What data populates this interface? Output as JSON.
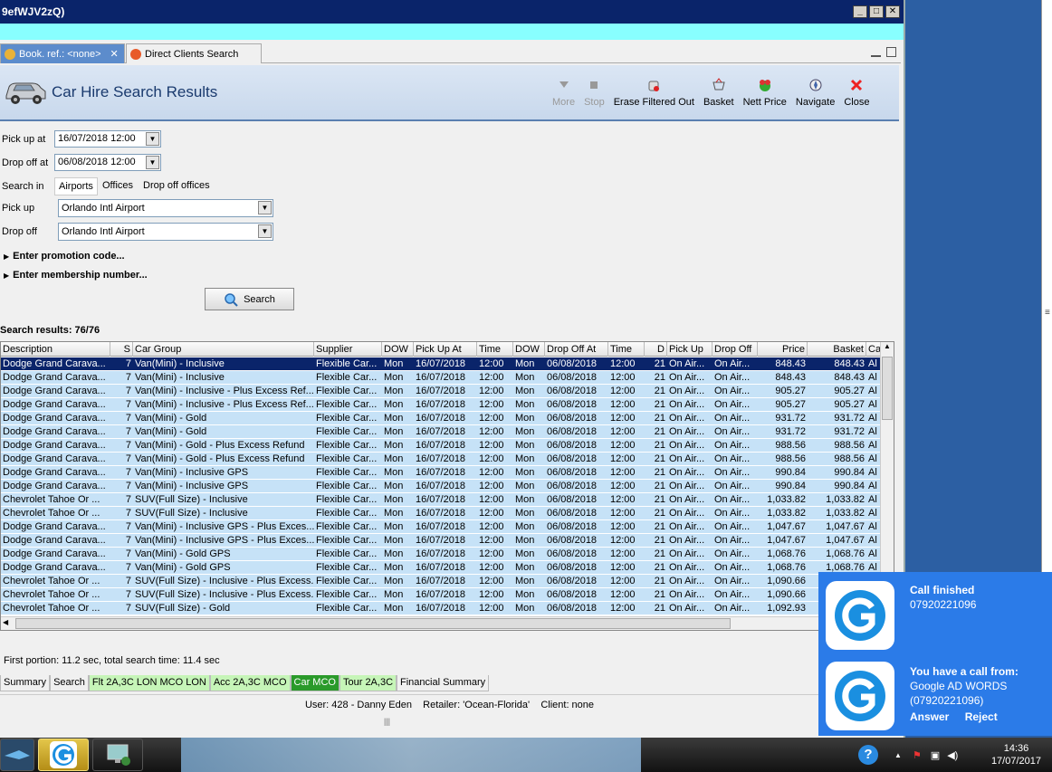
{
  "window": {
    "title": "9efWJV2zQ)"
  },
  "tabs": [
    {
      "label": "Book. ref.: <none>",
      "close": "✕"
    },
    {
      "label": "Direct Clients Search"
    }
  ],
  "header": {
    "title": "Car Hire Search Results"
  },
  "toolbar": {
    "more": "More",
    "stop": "Stop",
    "erase": "Erase Filtered Out",
    "basket": "Basket",
    "nett_price": "Nett Price",
    "navigate": "Navigate",
    "close": "Close"
  },
  "form": {
    "pickup_at_label": "Pick up at",
    "pickup_at_value": "16/07/2018 12:00",
    "dropoff_at_label": "Drop off at",
    "dropoff_at_value": "06/08/2018 12:00",
    "search_in_label": "Search in",
    "search_in_options": [
      "Airports",
      "Offices",
      "Drop off offices"
    ],
    "pickup_label": "Pick up",
    "pickup_value": "Orlando Intl Airport",
    "dropoff_label": "Drop off",
    "dropoff_value": "Orlando Intl Airport",
    "promo": "Enter promotion code...",
    "membership": "Enter membership number...",
    "search_button": "Search"
  },
  "results": {
    "count_label": "Search results: 76/76",
    "columns": [
      "Description",
      "S",
      "Car Group",
      "Supplier",
      "DOW",
      "Pick Up At",
      "Time",
      "DOW",
      "Drop Off At",
      "Time",
      "D",
      "Pick Up",
      "Drop Off",
      "Price",
      "Basket",
      "Ca"
    ],
    "rows": [
      [
        "Dodge Grand Carava...",
        "7",
        "Van(Mini) - Inclusive",
        "Flexible Car...",
        "Mon",
        "16/07/2018",
        "12:00",
        "Mon",
        "06/08/2018",
        "12:00",
        "21",
        "On Air...",
        "On Air...",
        "848.43",
        "848.43",
        "Al"
      ],
      [
        "Dodge Grand Carava...",
        "7",
        "Van(Mini) - Inclusive",
        "Flexible Car...",
        "Mon",
        "16/07/2018",
        "12:00",
        "Mon",
        "06/08/2018",
        "12:00",
        "21",
        "On Air...",
        "On Air...",
        "848.43",
        "848.43",
        "Al"
      ],
      [
        "Dodge Grand Carava...",
        "7",
        "Van(Mini) - Inclusive - Plus Excess Ref...",
        "Flexible Car...",
        "Mon",
        "16/07/2018",
        "12:00",
        "Mon",
        "06/08/2018",
        "12:00",
        "21",
        "On Air...",
        "On Air...",
        "905.27",
        "905.27",
        "Al"
      ],
      [
        "Dodge Grand Carava...",
        "7",
        "Van(Mini) - Inclusive - Plus Excess Ref...",
        "Flexible Car...",
        "Mon",
        "16/07/2018",
        "12:00",
        "Mon",
        "06/08/2018",
        "12:00",
        "21",
        "On Air...",
        "On Air...",
        "905.27",
        "905.27",
        "Al"
      ],
      [
        "Dodge Grand Carava...",
        "7",
        "Van(Mini) - Gold",
        "Flexible Car...",
        "Mon",
        "16/07/2018",
        "12:00",
        "Mon",
        "06/08/2018",
        "12:00",
        "21",
        "On Air...",
        "On Air...",
        "931.72",
        "931.72",
        "Al"
      ],
      [
        "Dodge Grand Carava...",
        "7",
        "Van(Mini) - Gold",
        "Flexible Car...",
        "Mon",
        "16/07/2018",
        "12:00",
        "Mon",
        "06/08/2018",
        "12:00",
        "21",
        "On Air...",
        "On Air...",
        "931.72",
        "931.72",
        "Al"
      ],
      [
        "Dodge Grand Carava...",
        "7",
        "Van(Mini) - Gold - Plus Excess Refund",
        "Flexible Car...",
        "Mon",
        "16/07/2018",
        "12:00",
        "Mon",
        "06/08/2018",
        "12:00",
        "21",
        "On Air...",
        "On Air...",
        "988.56",
        "988.56",
        "Al"
      ],
      [
        "Dodge Grand Carava...",
        "7",
        "Van(Mini) - Gold - Plus Excess Refund",
        "Flexible Car...",
        "Mon",
        "16/07/2018",
        "12:00",
        "Mon",
        "06/08/2018",
        "12:00",
        "21",
        "On Air...",
        "On Air...",
        "988.56",
        "988.56",
        "Al"
      ],
      [
        "Dodge Grand Carava...",
        "7",
        "Van(Mini) - Inclusive GPS",
        "Flexible Car...",
        "Mon",
        "16/07/2018",
        "12:00",
        "Mon",
        "06/08/2018",
        "12:00",
        "21",
        "On Air...",
        "On Air...",
        "990.84",
        "990.84",
        "Al"
      ],
      [
        "Dodge Grand Carava...",
        "7",
        "Van(Mini) - Inclusive GPS",
        "Flexible Car...",
        "Mon",
        "16/07/2018",
        "12:00",
        "Mon",
        "06/08/2018",
        "12:00",
        "21",
        "On Air...",
        "On Air...",
        "990.84",
        "990.84",
        "Al"
      ],
      [
        "Chevrolet Tahoe Or ...",
        "7",
        "SUV(Full Size) - Inclusive",
        "Flexible Car...",
        "Mon",
        "16/07/2018",
        "12:00",
        "Mon",
        "06/08/2018",
        "12:00",
        "21",
        "On Air...",
        "On Air...",
        "1,033.82",
        "1,033.82",
        "Al"
      ],
      [
        "Chevrolet Tahoe Or ...",
        "7",
        "SUV(Full Size) - Inclusive",
        "Flexible Car...",
        "Mon",
        "16/07/2018",
        "12:00",
        "Mon",
        "06/08/2018",
        "12:00",
        "21",
        "On Air...",
        "On Air...",
        "1,033.82",
        "1,033.82",
        "Al"
      ],
      [
        "Dodge Grand Carava...",
        "7",
        "Van(Mini) - Inclusive GPS - Plus Exces...",
        "Flexible Car...",
        "Mon",
        "16/07/2018",
        "12:00",
        "Mon",
        "06/08/2018",
        "12:00",
        "21",
        "On Air...",
        "On Air...",
        "1,047.67",
        "1,047.67",
        "Al"
      ],
      [
        "Dodge Grand Carava...",
        "7",
        "Van(Mini) - Inclusive GPS - Plus Exces...",
        "Flexible Car...",
        "Mon",
        "16/07/2018",
        "12:00",
        "Mon",
        "06/08/2018",
        "12:00",
        "21",
        "On Air...",
        "On Air...",
        "1,047.67",
        "1,047.67",
        "Al"
      ],
      [
        "Dodge Grand Carava...",
        "7",
        "Van(Mini) - Gold GPS",
        "Flexible Car...",
        "Mon",
        "16/07/2018",
        "12:00",
        "Mon",
        "06/08/2018",
        "12:00",
        "21",
        "On Air...",
        "On Air...",
        "1,068.76",
        "1,068.76",
        "Al"
      ],
      [
        "Dodge Grand Carava...",
        "7",
        "Van(Mini) - Gold GPS",
        "Flexible Car...",
        "Mon",
        "16/07/2018",
        "12:00",
        "Mon",
        "06/08/2018",
        "12:00",
        "21",
        "On Air...",
        "On Air...",
        "1,068.76",
        "1,068.76",
        "Al"
      ],
      [
        "Chevrolet Tahoe Or ...",
        "7",
        "SUV(Full Size) - Inclusive - Plus Excess...",
        "Flexible Car...",
        "Mon",
        "16/07/2018",
        "12:00",
        "Mon",
        "06/08/2018",
        "12:00",
        "21",
        "On Air...",
        "On Air...",
        "1,090.66",
        "1,090.66",
        "Al"
      ],
      [
        "Chevrolet Tahoe Or ...",
        "7",
        "SUV(Full Size) - Inclusive - Plus Excess...",
        "Flexible Car...",
        "Mon",
        "16/07/2018",
        "12:00",
        "Mon",
        "06/08/2018",
        "12:00",
        "21",
        "On Air...",
        "On Air...",
        "1,090.66",
        "1,090.66",
        "Al"
      ],
      [
        "Chevrolet Tahoe Or ...",
        "7",
        "SUV(Full Size) - Gold",
        "Flexible Car...",
        "Mon",
        "16/07/2018",
        "12:00",
        "Mon",
        "06/08/2018",
        "12:00",
        "21",
        "On Air...",
        "On Air...",
        "1,092.93",
        "1,092.93",
        "Al"
      ]
    ]
  },
  "status": {
    "timing": "First portion: 11.2 sec, total search time: 11.4 sec",
    "user_line": "User: 428 - Danny Eden    Retailer: 'Ocean-Florida'    Client: none"
  },
  "bottom_tabs": [
    {
      "label": "Summary",
      "style": "plain"
    },
    {
      "label": "Search",
      "style": "plain"
    },
    {
      "label": "Flt 2A,3C LON MCO LON",
      "style": "green"
    },
    {
      "label": "Acc 2A,3C MCO",
      "style": "green"
    },
    {
      "label": "Car MCO",
      "style": "dark"
    },
    {
      "label": "Tour 2A,3C",
      "style": "green"
    },
    {
      "label": "Financial Summary",
      "style": "plain"
    }
  ],
  "notification": {
    "call_finished_title": "Call finished",
    "call_finished_number": "07920221096",
    "incoming_title": "You have a call from:",
    "incoming_name": "Google AD WORDS",
    "incoming_number": "(07920221096)",
    "answer": "Answer",
    "reject": "Reject"
  },
  "taskbar": {
    "help": "?",
    "time": "14:36",
    "date": "17/07/2017"
  },
  "colors": {
    "row_bg": "#c6e2f7",
    "row_selected": "#0a246a",
    "notification_bg": "#2b7be8"
  }
}
